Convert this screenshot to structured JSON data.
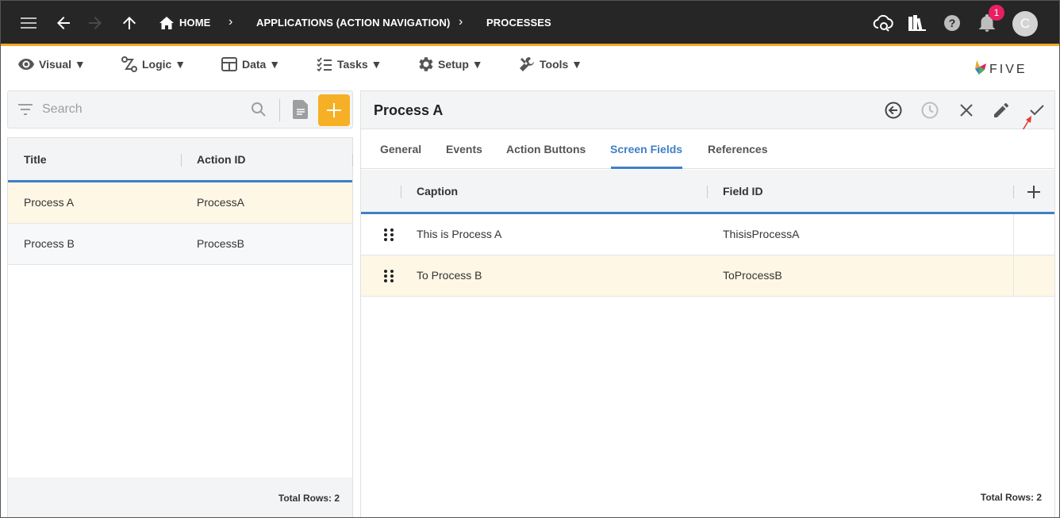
{
  "topbar": {
    "breadcrumbs": [
      "HOME",
      "APPLICATIONS (ACTION NAVIGATION)",
      "PROCESSES"
    ],
    "notification_count": "1",
    "avatar_initial": "C",
    "colors": {
      "background": "#262626",
      "accent": "#f5a623",
      "badge": "#e91e63"
    }
  },
  "menu": {
    "items": [
      {
        "label": "Visual ▼",
        "icon": "eye-icon"
      },
      {
        "label": "Logic ▼",
        "icon": "logic-flow-icon"
      },
      {
        "label": "Data ▼",
        "icon": "table-icon"
      },
      {
        "label": "Tasks ▼",
        "icon": "checklist-icon"
      },
      {
        "label": "Setup ▼",
        "icon": "gear-icon"
      },
      {
        "label": "Tools ▼",
        "icon": "tools-icon"
      }
    ],
    "logo_text": "FIVE"
  },
  "left": {
    "search_placeholder": "Search",
    "columns": [
      "Title",
      "Action ID"
    ],
    "rows": [
      {
        "title": "Process A",
        "action_id": "ProcessA"
      },
      {
        "title": "Process B",
        "action_id": "ProcessB"
      }
    ],
    "total_rows": "Total Rows: 2"
  },
  "right": {
    "title": "Process A",
    "tabs": [
      "General",
      "Events",
      "Action Buttons",
      "Screen Fields",
      "References"
    ],
    "active_tab": "Screen Fields",
    "columns": [
      "Caption",
      "Field ID"
    ],
    "rows": [
      {
        "caption": "This is Process A",
        "field_id": "ThisisProcessA"
      },
      {
        "caption": "To Process B",
        "field_id": "ToProcessB"
      }
    ],
    "total_rows": "Total Rows: 2"
  },
  "colors": {
    "accent_blue": "#3f7fc7",
    "selected_row": "#fff7e6",
    "add_button": "#f5b025"
  }
}
